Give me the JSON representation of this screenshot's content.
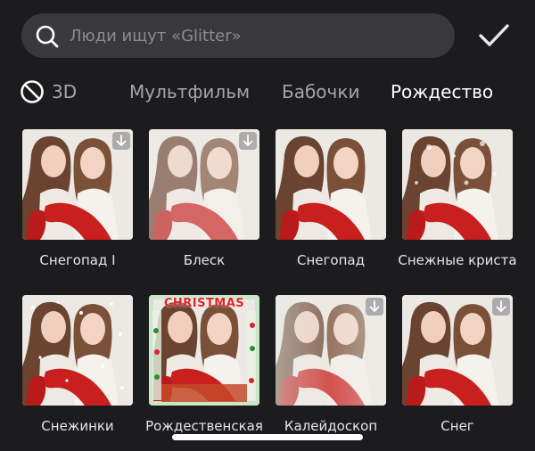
{
  "search": {
    "placeholder": "Люди ищут «Glitter»"
  },
  "tabs": [
    {
      "label": "3D"
    },
    {
      "label": "Мультфильм"
    },
    {
      "label": "Бабочки"
    },
    {
      "label": "Рождество",
      "active": true
    }
  ],
  "effects": [
    {
      "label": "Снегопад I",
      "download": true,
      "overlay": "none"
    },
    {
      "label": "Блеск",
      "download": true,
      "overlay": "fade"
    },
    {
      "label": "Снегопад",
      "download": false,
      "overlay": "none"
    },
    {
      "label": "Снежные криста",
      "download": false,
      "overlay": "crystals"
    },
    {
      "label": "Снежинки",
      "download": false,
      "overlay": "snow"
    },
    {
      "label": "Рождественская",
      "download": false,
      "overlay": "frame",
      "frame_text": "CHRISTMAS"
    },
    {
      "label": "Калейдоскоп",
      "download": true,
      "overlay": "kaleido"
    },
    {
      "label": "Снег",
      "download": true,
      "overlay": "none"
    }
  ],
  "colors": {
    "background": "#1c1c1e",
    "search_bg": "#39393c",
    "dress_red": "#c8201e"
  }
}
